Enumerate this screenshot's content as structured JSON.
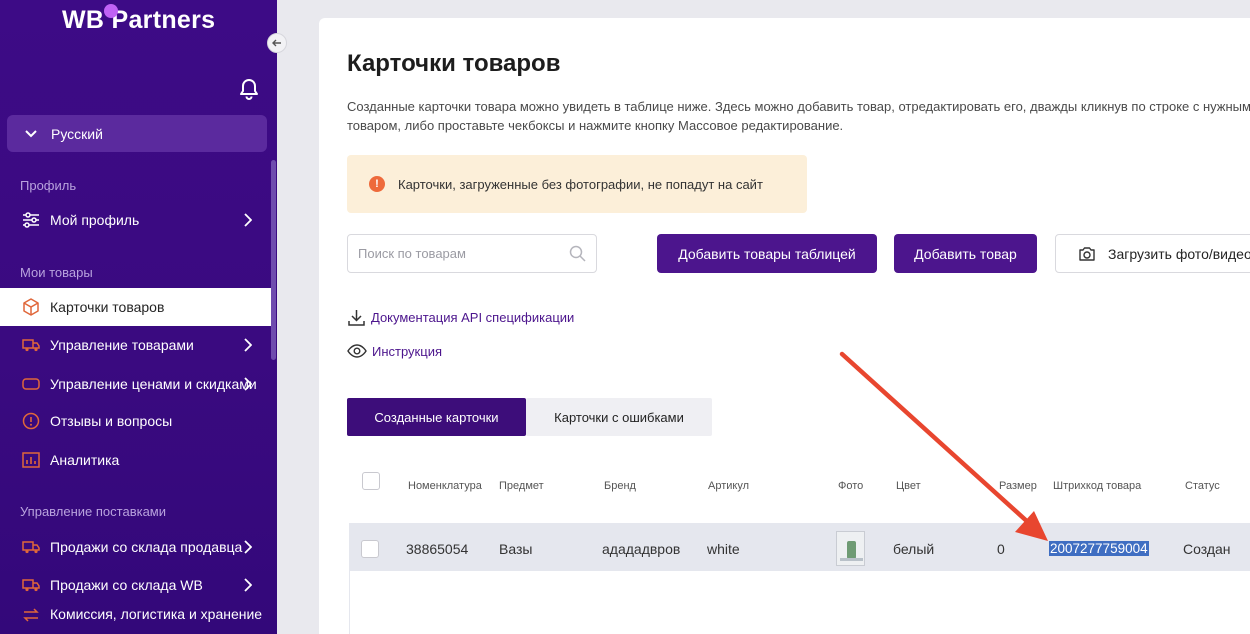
{
  "sidebar": {
    "logo": "WB Partners",
    "language": "Русский",
    "sections": {
      "profile": "Профиль",
      "my_goods": "Мои товары",
      "supplies": "Управление поставками"
    },
    "items": {
      "my_profile": "Мой профиль",
      "product_cards": "Карточки товаров",
      "goods_management": "Управление товарами",
      "prices_discounts": "Управление ценами и скидками",
      "reviews": "Отзывы и вопросы",
      "analytics": "Аналитика",
      "seller_warehouse": "Продажи со склада продавца",
      "wb_warehouse": "Продажи со склада WB",
      "commission": "Комиссия, логистика и хранение"
    }
  },
  "main": {
    "title": "Карточки товаров",
    "description": "Созданные карточки товара можно увидеть в таблице ниже. Здесь можно добавить товар, отредактировать его, дважды кликнув по строке с нужным товаром, либо проставьте чекбоксы и нажмите кнопку Массовое редактирование.",
    "warning": "Карточки, загруженные без фотографии, не попадут на сайт",
    "search_placeholder": "Поиск по товарам",
    "buttons": {
      "add_table": "Добавить товары таблицей",
      "add_item": "Добавить товар",
      "upload_media": "Загрузить фото/видео"
    },
    "links": {
      "api_docs": "Документация API спецификации",
      "instruction": "Инструкция"
    },
    "tabs": [
      "Созданные карточки",
      "Карточки с ошибками"
    ],
    "table": {
      "headers": [
        "Номенклатура",
        "Предмет",
        "Бренд",
        "Артикул",
        "Фото",
        "Цвет",
        "Размер",
        "Штрихкод товара",
        "Статус"
      ],
      "rows": [
        {
          "nomenclature": "38865054",
          "subject": "Вазы",
          "brand": "адададвров",
          "article": "white",
          "color": "белый",
          "size": "0",
          "barcode": "2007277759004",
          "status": "Создан"
        }
      ]
    }
  },
  "colors": {
    "sidebar_bg": "#3d0b86",
    "primary_button": "#4c158d",
    "annotation_arrow": "#e8462f",
    "warning_bg": "#fcefd9"
  }
}
